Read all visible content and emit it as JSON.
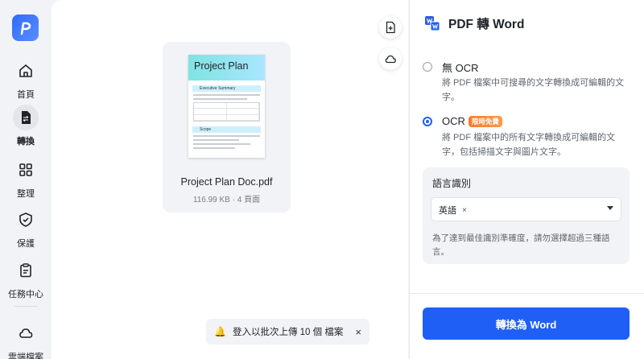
{
  "sidebar": {
    "items": [
      {
        "label": "首頁",
        "icon": "home-icon"
      },
      {
        "label": "轉換",
        "icon": "convert-icon",
        "active": true
      },
      {
        "label": "整理",
        "icon": "grid-icon"
      },
      {
        "label": "保護",
        "icon": "shield-icon"
      },
      {
        "label": "任務中心",
        "icon": "clipboard-icon"
      },
      {
        "label": "雲端檔案",
        "icon": "cloud-icon"
      }
    ]
  },
  "file": {
    "name": "Project Plan Doc.pdf",
    "meta": "116.99 KB · 4 頁面",
    "thumb_title": "Project Plan",
    "thumb_section_1": "Executive Summary",
    "thumb_section_2": "Scope"
  },
  "toast": {
    "text": "登入以批次上傳 10 個 檔案",
    "close": "×"
  },
  "panel": {
    "title": "PDF 轉 Word",
    "options": [
      {
        "title": "無 OCR",
        "desc": "將 PDF 檔案中可搜尋的文字轉換成可編輯的文字。",
        "checked": false
      },
      {
        "title": "OCR",
        "badge": "限時免費",
        "desc": "將 PDF 檔案中的所有文字轉換成可編輯的文字，包括掃描文字與圖片文字。",
        "checked": true
      }
    ],
    "language": {
      "title": "語言識別",
      "selected": "英語",
      "remove": "×",
      "hint": "為了達到最佳識別準確度，請勿選擇超過三種語言。"
    },
    "convert_label": "轉換為 Word"
  },
  "colors": {
    "accent": "#1f5ff5",
    "badge": "#ff7a2b",
    "sidebar_bg": "#f2f3f6"
  }
}
